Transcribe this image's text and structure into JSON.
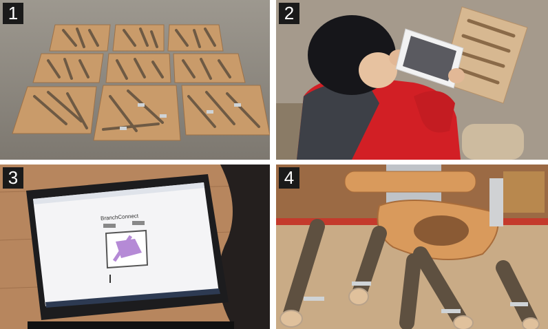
{
  "panels": [
    {
      "number": "1"
    },
    {
      "number": "2"
    },
    {
      "number": "3",
      "screen_title": "BranchConnect"
    },
    {
      "number": "4"
    }
  ],
  "colors": {
    "concrete": "#8f8a82",
    "plywood": "#c99b6a",
    "jacket_red": "#d21f25",
    "jacket_gray": "#3d4047",
    "laptop": "#1c1c1e",
    "screen": "#f4f4f6",
    "highlight_purple": "#b58ad6",
    "wood_orange": "#d99a5c",
    "sawdust": "#c9ab86"
  }
}
